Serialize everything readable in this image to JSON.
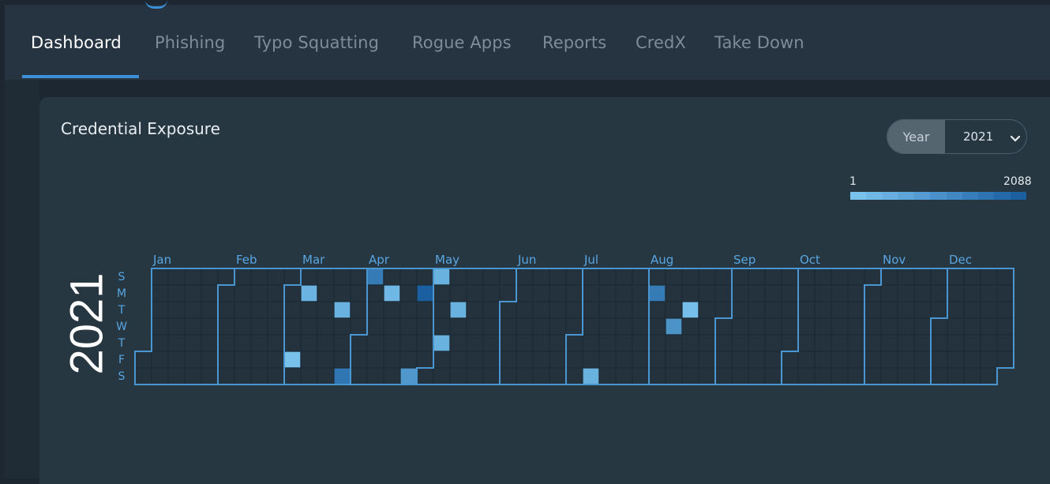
{
  "nav": {
    "tabs": [
      {
        "label": "Dashboard",
        "active": true
      },
      {
        "label": "Phishing",
        "active": false
      },
      {
        "label": "Typo Squatting",
        "active": false
      },
      {
        "label": "Rogue Apps",
        "active": false
      },
      {
        "label": "Reports",
        "active": false
      },
      {
        "label": "CredX",
        "active": false
      },
      {
        "label": "Take Down",
        "active": false
      }
    ]
  },
  "card": {
    "title": "Credential Exposure",
    "year_control": {
      "label": "Year",
      "selected": "2021"
    },
    "legend": {
      "min": "1",
      "max": "2088",
      "colors": [
        "#79c2ec",
        "#6fb8e6",
        "#66afe0",
        "#5ca5d9",
        "#539bd2",
        "#4991cb",
        "#4087c3",
        "#367dbb",
        "#2d73b2",
        "#2369a9",
        "#1a5fa0"
      ]
    }
  },
  "heatmap": {
    "year": "2021",
    "weekday_labels": [
      "S",
      "M",
      "T",
      "W",
      "T",
      "F",
      "S"
    ],
    "month_labels": [
      "Jan",
      "Feb",
      "Mar",
      "Apr",
      "May",
      "Jun",
      "Jul",
      "Aug",
      "Sep",
      "Oct",
      "Nov",
      "Dec"
    ],
    "colors": {
      "empty": "#24323d",
      "grid": "#1c2a35",
      "month_border": "#4a96d1",
      "low": "#79c2ec",
      "high": "#1a5fa0",
      "weekday_label": "#59a6e2",
      "month_label": "#59a6e2"
    },
    "range": {
      "min": 1,
      "max": 2088
    },
    "values": [
      {
        "date": "2021-03-05",
        "value": 30
      },
      {
        "date": "2021-03-08",
        "value": 300
      },
      {
        "date": "2021-03-23",
        "value": 350
      },
      {
        "date": "2021-03-27",
        "value": 1600
      },
      {
        "date": "2021-04-04",
        "value": 1500
      },
      {
        "date": "2021-04-12",
        "value": 230
      },
      {
        "date": "2021-04-24",
        "value": 900
      },
      {
        "date": "2021-04-26",
        "value": 2088
      },
      {
        "date": "2021-05-02",
        "value": 350
      },
      {
        "date": "2021-05-06",
        "value": 360
      },
      {
        "date": "2021-05-11",
        "value": 350
      },
      {
        "date": "2021-07-10",
        "value": 350
      },
      {
        "date": "2021-08-02",
        "value": 1500
      },
      {
        "date": "2021-08-11",
        "value": 1000
      },
      {
        "date": "2021-08-17",
        "value": 60
      }
    ]
  }
}
